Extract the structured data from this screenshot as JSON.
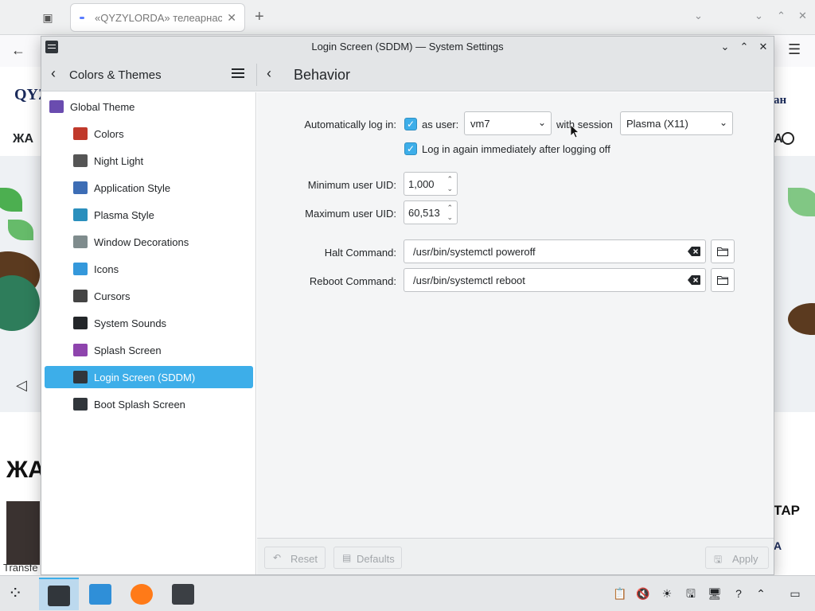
{
  "browser": {
    "tab_title": "«QYZYLORDA» телеарнасы",
    "new_tab": "+",
    "close_tab": "✕"
  },
  "website": {
    "logo": "QYZ",
    "lang": "ан",
    "nav_left": "ЖА",
    "nav_right": "А",
    "big_heading": "ЖА",
    "right_heading": "ТАР",
    "right_sub": "А",
    "transfer_text": "Transfe"
  },
  "window": {
    "title": "Login Screen (SDDM) — System Settings",
    "category_title": "Colors & Themes",
    "page_title": "Behavior",
    "sidebar": [
      {
        "label": "Global Theme",
        "icon": "global-theme-icon",
        "color": "#6a4caf"
      },
      {
        "label": "Colors",
        "icon": "colors-icon",
        "color": "#c0392b"
      },
      {
        "label": "Night Light",
        "icon": "night-light-icon",
        "color": "#555555"
      },
      {
        "label": "Application Style",
        "icon": "application-style-icon",
        "color": "#3d6db5"
      },
      {
        "label": "Plasma Style",
        "icon": "plasma-style-icon",
        "color": "#2a8fbd"
      },
      {
        "label": "Window Decorations",
        "icon": "window-decorations-icon",
        "color": "#7f8c8d"
      },
      {
        "label": "Icons",
        "icon": "icons-icon",
        "color": "#3498db"
      },
      {
        "label": "Cursors",
        "icon": "cursors-icon",
        "color": "#444444"
      },
      {
        "label": "System Sounds",
        "icon": "system-sounds-icon",
        "color": "#232629"
      },
      {
        "label": "Splash Screen",
        "icon": "splash-screen-icon",
        "color": "#8e44ad"
      },
      {
        "label": "Login Screen (SDDM)",
        "icon": "login-screen-icon",
        "color": "#31363b"
      },
      {
        "label": "Boot Splash Screen",
        "icon": "boot-splash-icon",
        "color": "#31363b"
      }
    ],
    "active_item": "Login Screen (SDDM)",
    "form": {
      "autologin_label": "Automatically log in:",
      "as_user_label": "as user:",
      "as_user_checked": true,
      "user_value": "vm7",
      "with_session_label": "with session",
      "session_value": "Plasma (X11)",
      "relogin_label": "Log in again immediately after logging off",
      "relogin_checked": true,
      "min_uid_label": "Minimum user UID:",
      "min_uid_value": "1,000",
      "max_uid_label": "Maximum user UID:",
      "max_uid_value": "60,513",
      "halt_label": "Halt Command:",
      "halt_value": "/usr/bin/systemctl poweroff",
      "reboot_label": "Reboot Command:",
      "reboot_value": "/usr/bin/systemctl reboot"
    },
    "footer": {
      "reset": "Reset",
      "defaults": "Defaults",
      "apply": "Apply"
    }
  },
  "taskbar": {
    "tasks": [
      {
        "name": "system-settings",
        "active": true
      },
      {
        "name": "discover",
        "active": false
      },
      {
        "name": "firefox",
        "active": false
      },
      {
        "name": "konsole",
        "active": false
      }
    ],
    "tray_icons": [
      "clipboard-icon",
      "volume-muted-icon",
      "brightness-icon",
      "storage-icon",
      "network-icon",
      "help-icon",
      "tray-expand-icon",
      "show-desktop-icon"
    ]
  },
  "colors": {
    "accent": "#3daee9",
    "window_bg": "#eff0f1"
  }
}
